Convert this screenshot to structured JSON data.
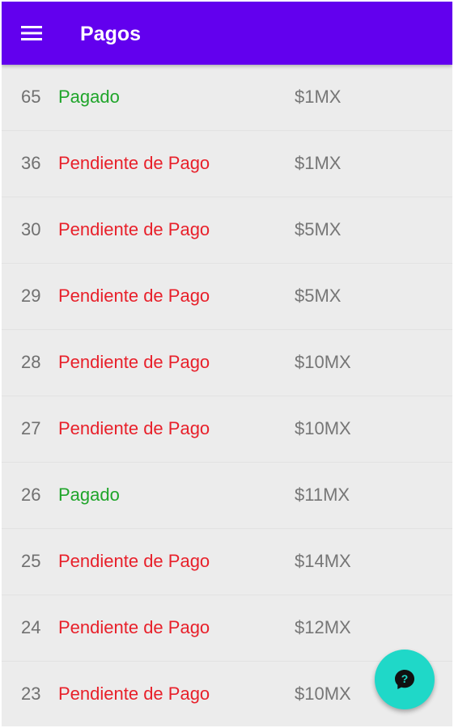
{
  "app_bar": {
    "title": "Pagos",
    "menu_icon": "hamburger-menu-icon",
    "background_color": "#6200ee"
  },
  "status_colors": {
    "paid": "#1fa52a",
    "pending": "#e8202a"
  },
  "payments": [
    {
      "number": "65",
      "status": "Pagado",
      "status_type": "paid",
      "amount": "$1MX"
    },
    {
      "number": "36",
      "status": "Pendiente de Pago",
      "status_type": "pending",
      "amount": "$1MX"
    },
    {
      "number": "30",
      "status": "Pendiente de Pago",
      "status_type": "pending",
      "amount": "$5MX"
    },
    {
      "number": "29",
      "status": "Pendiente de Pago",
      "status_type": "pending",
      "amount": "$5MX"
    },
    {
      "number": "28",
      "status": "Pendiente de Pago",
      "status_type": "pending",
      "amount": "$10MX"
    },
    {
      "number": "27",
      "status": "Pendiente de Pago",
      "status_type": "pending",
      "amount": "$10MX"
    },
    {
      "number": "26",
      "status": "Pagado",
      "status_type": "paid",
      "amount": "$11MX"
    },
    {
      "number": "25",
      "status": "Pendiente de Pago",
      "status_type": "pending",
      "amount": "$14MX"
    },
    {
      "number": "24",
      "status": "Pendiente de Pago",
      "status_type": "pending",
      "amount": "$12MX"
    },
    {
      "number": "23",
      "status": "Pendiente de Pago",
      "status_type": "pending",
      "amount": "$10MX"
    }
  ],
  "fab": {
    "icon": "help-icon",
    "color": "#1fd8c8"
  }
}
